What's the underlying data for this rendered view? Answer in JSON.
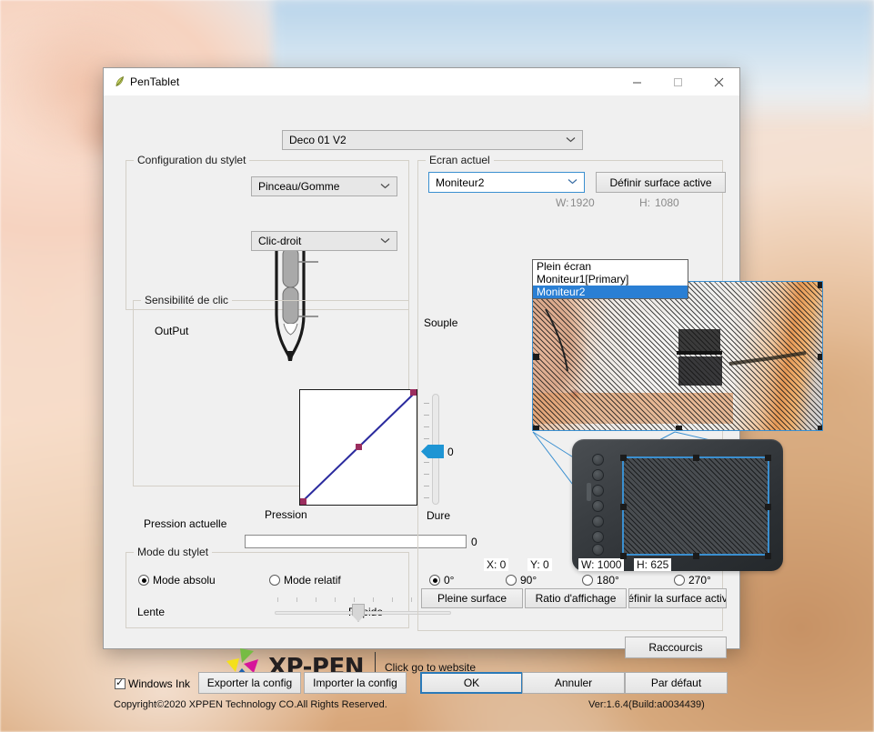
{
  "window": {
    "title": "PenTablet",
    "icon": "pentablet-icon",
    "minimize": "−",
    "maximize": "□",
    "close": "✕"
  },
  "device_selector": {
    "value": "Deco 01 V2",
    "chevron": "chevron-down-icon"
  },
  "pen_config": {
    "legend": "Configuration du stylet",
    "upper_button": {
      "value": "Pinceau/Gomme",
      "chevron": "chevron-down-icon"
    },
    "lower_button": {
      "value": "Clic-droit",
      "chevron": "chevron-down-icon"
    }
  },
  "click_sensitivity": {
    "legend": "Sensibilité de clic",
    "y_axis_label": "OutPut",
    "x_axis_label": "Pression",
    "slider_top_label": "Souple",
    "slider_bottom_label": "Dure",
    "slider_value": "0",
    "current_pressure_label": "Pression actuelle",
    "current_pressure_value": "0"
  },
  "pen_mode": {
    "legend": "Mode du stylet",
    "absolute_label": "Mode absolu",
    "relative_label": "Mode relatif",
    "selected": "absolute",
    "speed_slow_label": "Lente",
    "speed_fast_label": "Rapide"
  },
  "current_screen": {
    "legend": "Ecran actuel",
    "monitor_selector": {
      "value": "Moniteur2",
      "chevron": "chevron-down-icon"
    },
    "define_area_button": "Définir surface active",
    "width_label": "W:",
    "width_value": "1920",
    "height_label": "H:",
    "height_value": "1080",
    "dropdown_options": [
      {
        "label": "Plein écran",
        "selected": false
      },
      {
        "label": "Moniteur1[Primary]",
        "selected": false
      },
      {
        "label": "Moniteur2",
        "selected": true
      }
    ]
  },
  "tablet_area": {
    "x_label": "X: 0",
    "y_label": "Y: 0",
    "w_label": "W: 1000",
    "h_label": "H: 625",
    "rotations": [
      {
        "label": "0°",
        "selected": true
      },
      {
        "label": "90°",
        "selected": false
      },
      {
        "label": "180°",
        "selected": false
      },
      {
        "label": "270°",
        "selected": false
      }
    ],
    "buttons": [
      "Pleine surface",
      "Ratio d'affichage",
      "éfinir la surface activ"
    ]
  },
  "footer": {
    "brand_name": "XP-PEN",
    "brand_tagline": "Click go to website",
    "shortcuts_button": "Raccourcis",
    "windows_ink_label": "Windows Ink",
    "windows_ink_checked": true,
    "export_button": "Exporter la config",
    "import_button": "Importer la config",
    "ok_button": "OK",
    "cancel_button": "Annuler",
    "default_button": "Par défaut",
    "copyright": "Copyright©2020  XPPEN  Technology CO.All Rights Reserved.",
    "version": "Ver:1.6.4(Build:a0034439)"
  },
  "colors": {
    "accent_blue": "#2a7fd4",
    "selection_blue": "#2a7fd4",
    "curve_blue": "#2b2b9e",
    "point_magenta": "#9b2d5e",
    "slider_blue": "#1e95d4",
    "outline_blue": "#3a8fd0"
  }
}
